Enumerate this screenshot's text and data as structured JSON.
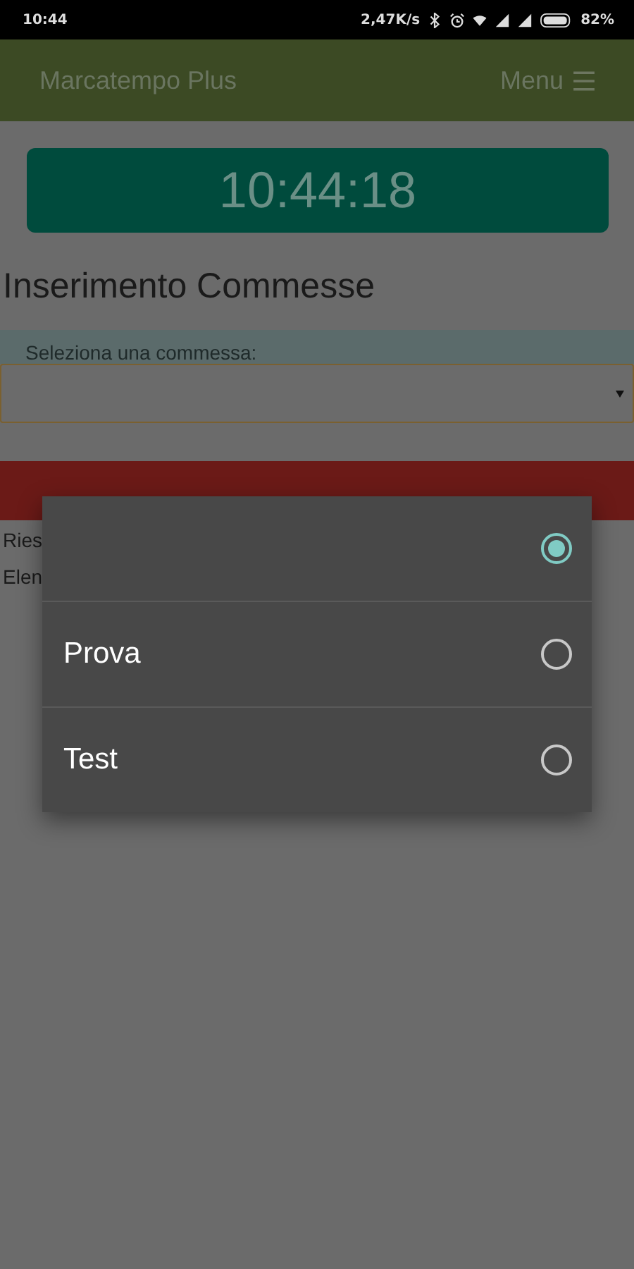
{
  "status_bar": {
    "time": "10:44",
    "speed": "2,47K/s",
    "battery": "82%"
  },
  "app_bar": {
    "title": "Marcatempo Plus",
    "menu": "Menu"
  },
  "clock": "10:44:18",
  "heading": "Inserimento Commesse",
  "select": {
    "label": "Seleziona una commessa:"
  },
  "lines": [
    "Ries",
    "Elen"
  ],
  "dialog": {
    "options": [
      {
        "selected": true
      },
      {
        "label": "Prova",
        "selected": false
      },
      {
        "label": "Test",
        "selected": false
      }
    ]
  }
}
